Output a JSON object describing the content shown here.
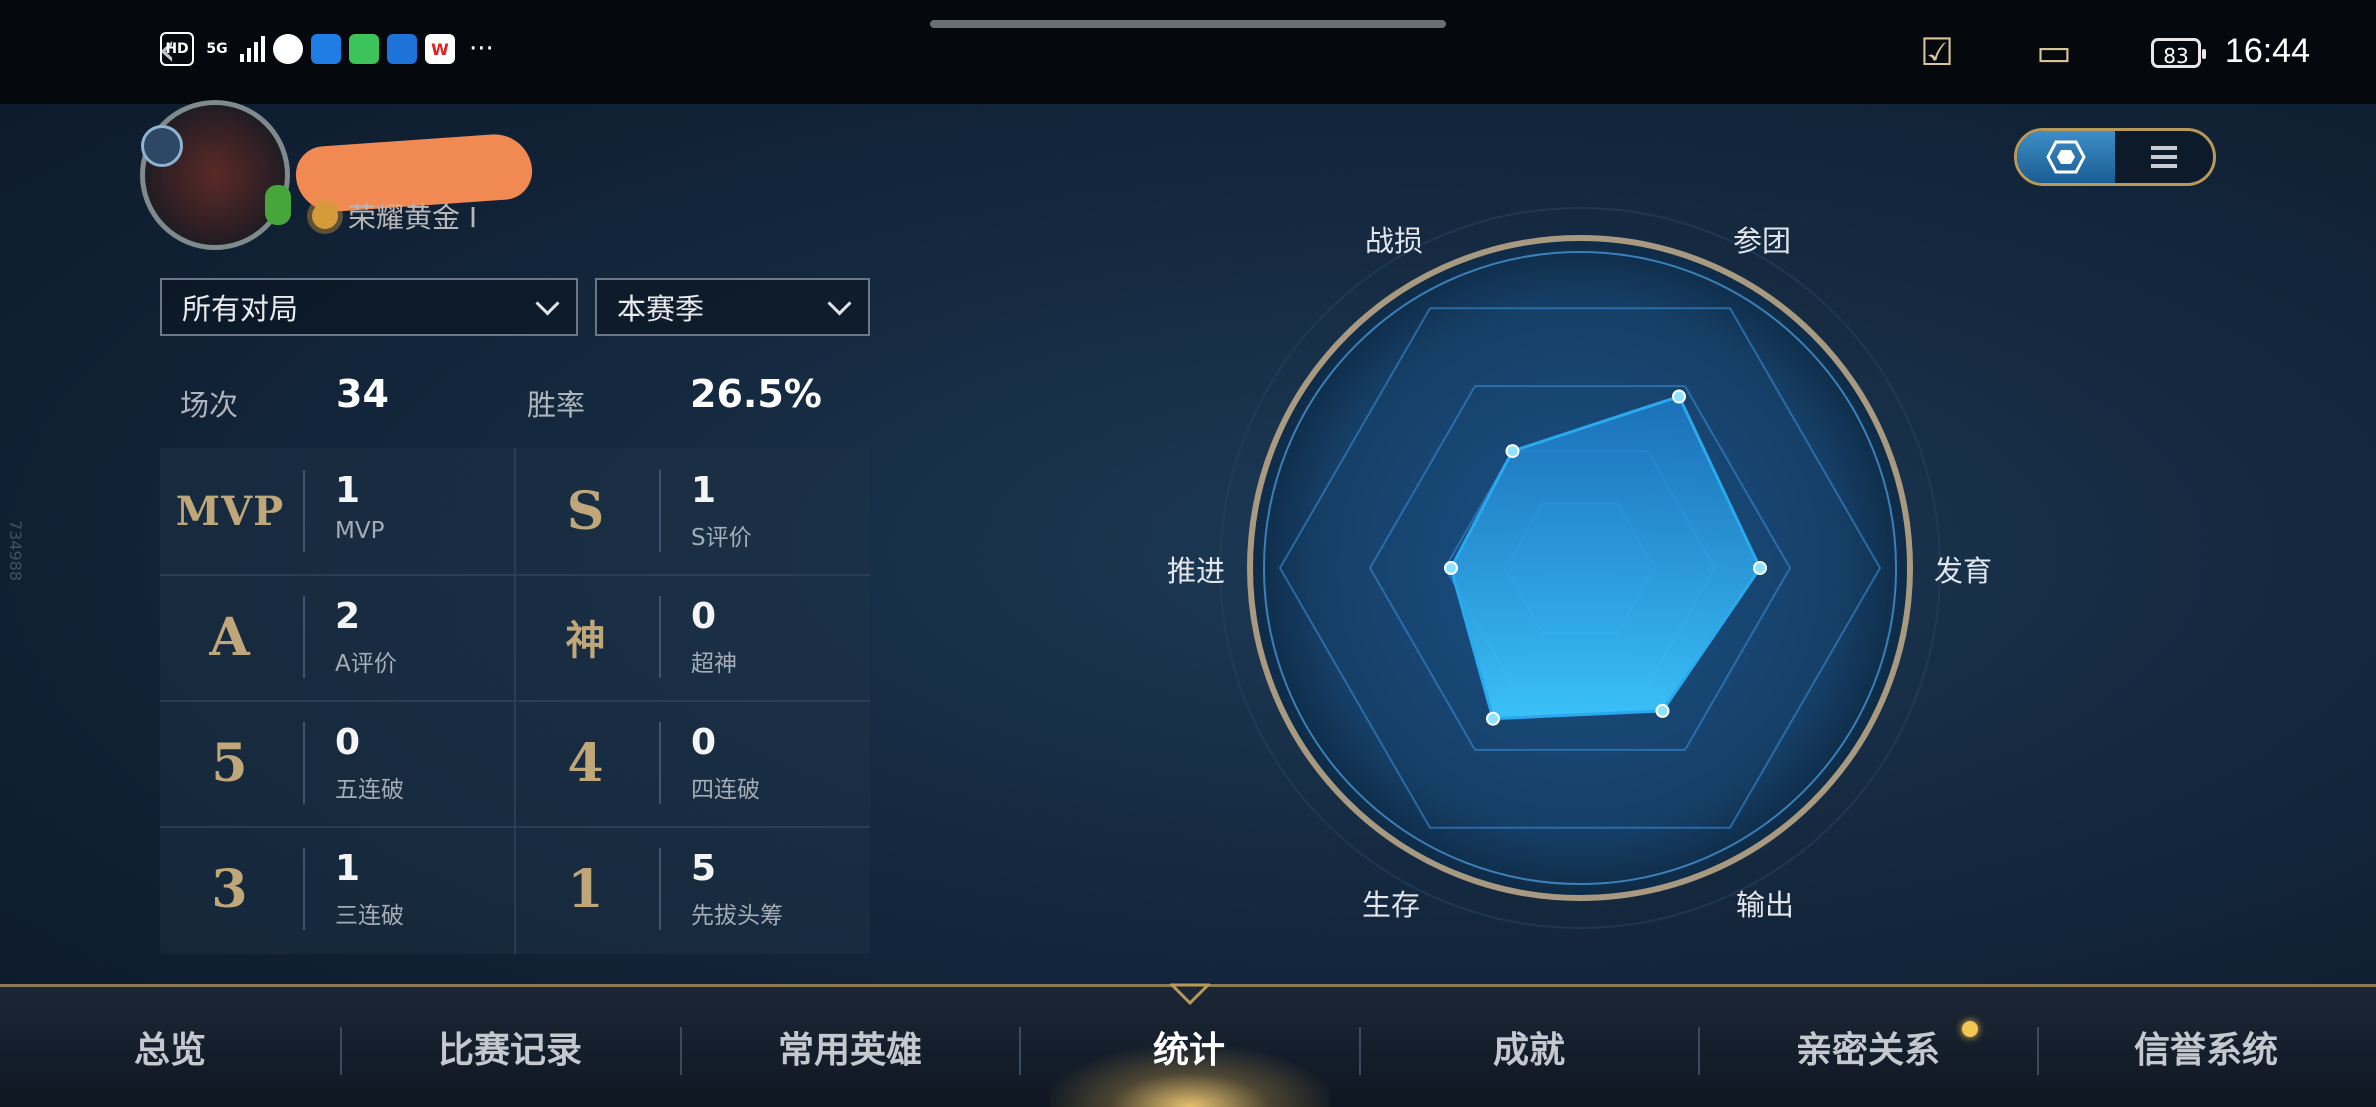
{
  "status_bar": {
    "time": "16:44",
    "battery": "83",
    "network": "5G",
    "hd_label": "HD",
    "more": "···",
    "icons": [
      "hd-icon",
      "signal-icon",
      "wechat-icon",
      "cloud-icon",
      "messages-icon",
      "bulb-icon",
      "wps-icon"
    ]
  },
  "profile": {
    "rank": "荣耀黄金 I"
  },
  "filters": {
    "mode": "所有对局",
    "season": "本赛季"
  },
  "summary": {
    "matches_label": "场次",
    "matches_value": "34",
    "winrate_label": "胜率",
    "winrate_value": "26.5%"
  },
  "stats": [
    {
      "badge": "MVP",
      "value": "1",
      "label": "MVP"
    },
    {
      "badge": "S",
      "value": "1",
      "label": "S评价"
    },
    {
      "badge": "A",
      "value": "2",
      "label": "A评价"
    },
    {
      "badge": "神",
      "value": "0",
      "label": "超神"
    },
    {
      "badge": "5",
      "value": "0",
      "label": "五连破"
    },
    {
      "badge": "4",
      "value": "0",
      "label": "四连破"
    },
    {
      "badge": "3",
      "value": "1",
      "label": "三连破"
    },
    {
      "badge": "1",
      "value": "5",
      "label": "先拔头筹"
    }
  ],
  "radar": {
    "axes": [
      "参团",
      "发育",
      "输出",
      "生存",
      "推进",
      "战损"
    ],
    "values": [
      0.66,
      0.6,
      0.55,
      0.58,
      0.43,
      0.45
    ]
  },
  "nav": {
    "tabs": [
      "总览",
      "比赛记录",
      "常用英雄",
      "统计",
      "成就",
      "亲密关系",
      "信誉系统"
    ],
    "active": "统计"
  },
  "side_id": "734988",
  "colors": {
    "accent": "#c0a77a",
    "radar_fill": "#29a9ee"
  }
}
